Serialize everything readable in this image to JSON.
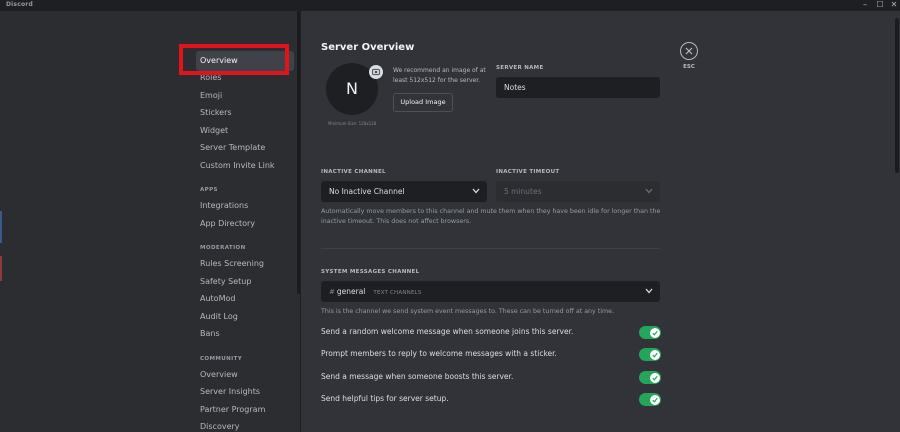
{
  "window": {
    "title": "Discord",
    "minimize": "–",
    "maximize": "☐",
    "close": "✕"
  },
  "sidebar": {
    "items": [
      {
        "label": "Overview",
        "selected": true
      },
      {
        "label": "Roles"
      },
      {
        "label": "Emoji"
      },
      {
        "label": "Stickers"
      },
      {
        "label": "Widget"
      },
      {
        "label": "Server Template"
      },
      {
        "label": "Custom Invite Link"
      }
    ],
    "apps": {
      "header": "APPS",
      "items": [
        {
          "label": "Integrations"
        },
        {
          "label": "App Directory"
        }
      ]
    },
    "moderation": {
      "header": "MODERATION",
      "items": [
        {
          "label": "Rules Screening"
        },
        {
          "label": "Safety Setup"
        },
        {
          "label": "AutoMod"
        },
        {
          "label": "Audit Log"
        },
        {
          "label": "Bans"
        }
      ]
    },
    "community": {
      "header": "COMMUNITY",
      "items": [
        {
          "label": "Overview"
        },
        {
          "label": "Server Insights"
        },
        {
          "label": "Partner Program"
        },
        {
          "label": "Discovery"
        }
      ]
    }
  },
  "main": {
    "title": "Server Overview",
    "avatar": {
      "letter": "N",
      "note": "Minimum Size: 128x128"
    },
    "recommend_text": "We recommend an image of at least 512x512 for the server.",
    "upload_button": "Upload Image",
    "server_name": {
      "label": "SERVER NAME",
      "value": "Notes"
    },
    "inactive_channel": {
      "label": "INACTIVE CHANNEL",
      "value": "No Inactive Channel"
    },
    "inactive_timeout": {
      "label": "INACTIVE TIMEOUT",
      "value": "5 minutes"
    },
    "inactive_help": "Automatically move members to this channel and mute them when they have been idle for longer than the inactive timeout. This does not affect browsers.",
    "system_channel": {
      "label": "SYSTEM MESSAGES CHANNEL",
      "hash": "#",
      "value": "general",
      "category": "TEXT CHANNELS"
    },
    "system_help": "This is the channel we send system event messages to. These can be turned off at any time.",
    "toggles": [
      {
        "label": "Send a random welcome message when someone joins this server.",
        "on": true
      },
      {
        "label": "Prompt members to reply to welcome messages with a sticker.",
        "on": true
      },
      {
        "label": "Send a message when someone boosts this server.",
        "on": true
      },
      {
        "label": "Send helpful tips for server setup.",
        "on": true
      }
    ],
    "close_label": "ESC"
  },
  "colors": {
    "accent_green": "#23a55a",
    "highlight_red": "#e3131b",
    "sidebar_bg": "#2b2d31",
    "main_bg": "#313338"
  }
}
